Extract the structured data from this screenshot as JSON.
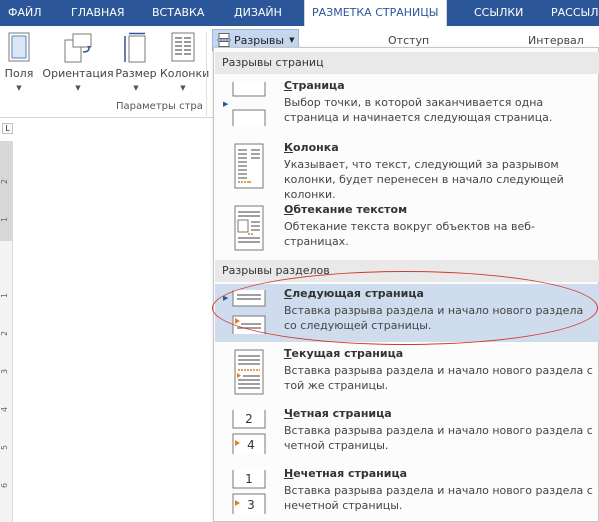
{
  "ribbon_tabs": {
    "file": "ФАЙЛ",
    "home": "ГЛАВНАЯ",
    "insert": "ВСТАВКА",
    "design": "ДИЗАЙН",
    "layout": "РАЗМЕТКА СТРАНИЦЫ",
    "references": "ССЫЛКИ",
    "mailings": "РАССЫЛ"
  },
  "ribbon": {
    "margins": "Поля",
    "orientation": "Ориентация",
    "size": "Размер",
    "columns": "Колонки",
    "breaks": "Разрывы",
    "indent": "Отступ",
    "spacing": "Интервал",
    "group_label": "Параметры стра"
  },
  "ruler": {
    "corner": "L",
    "numbers": [
      "2",
      "1",
      "1",
      "2",
      "3",
      "4",
      "5",
      "6"
    ]
  },
  "menu": {
    "page_breaks_header": "Разрывы страниц",
    "section_breaks_header": "Разрывы разделов",
    "items": [
      {
        "title_u": "С",
        "title": "траница",
        "desc": "Выбор точки, в которой заканчивается одна страница и начинается следующая страница."
      },
      {
        "title_u": "К",
        "title": "олонка",
        "desc": "Указывает, что текст, следующий за разрывом колонки, будет перенесен в начало следующей колонки."
      },
      {
        "title_u": "О",
        "title": "бтекание текстом",
        "desc": "Обтекание текста вокруг объектов на веб-страницах."
      },
      {
        "title_u": "С",
        "title": "ледующая страница",
        "desc": "Вставка разрыва раздела и начало нового раздела со следующей страницы."
      },
      {
        "title_u": "Т",
        "title": "екущая страница",
        "desc": "Вставка разрыва раздела и начало нового раздела с той же страницы."
      },
      {
        "title_u": "Ч",
        "title": "етная страница",
        "desc": "Вставка разрыва раздела и начало нового раздела с четной страницы."
      },
      {
        "title_u": "Н",
        "title": "ечетная страница",
        "desc": "Вставка разрыва раздела и начало нового раздела с нечетной страницы."
      }
    ],
    "icon_numbers": {
      "even_top": "2",
      "even_bottom": "4",
      "odd_top": "1",
      "odd_bottom": "3"
    }
  },
  "colors": {
    "ribbon_blue": "#2b579a",
    "hover_bg": "#cfdcee",
    "highlight_ring": "#d23a2e",
    "icon_orange": "#d9822b"
  }
}
